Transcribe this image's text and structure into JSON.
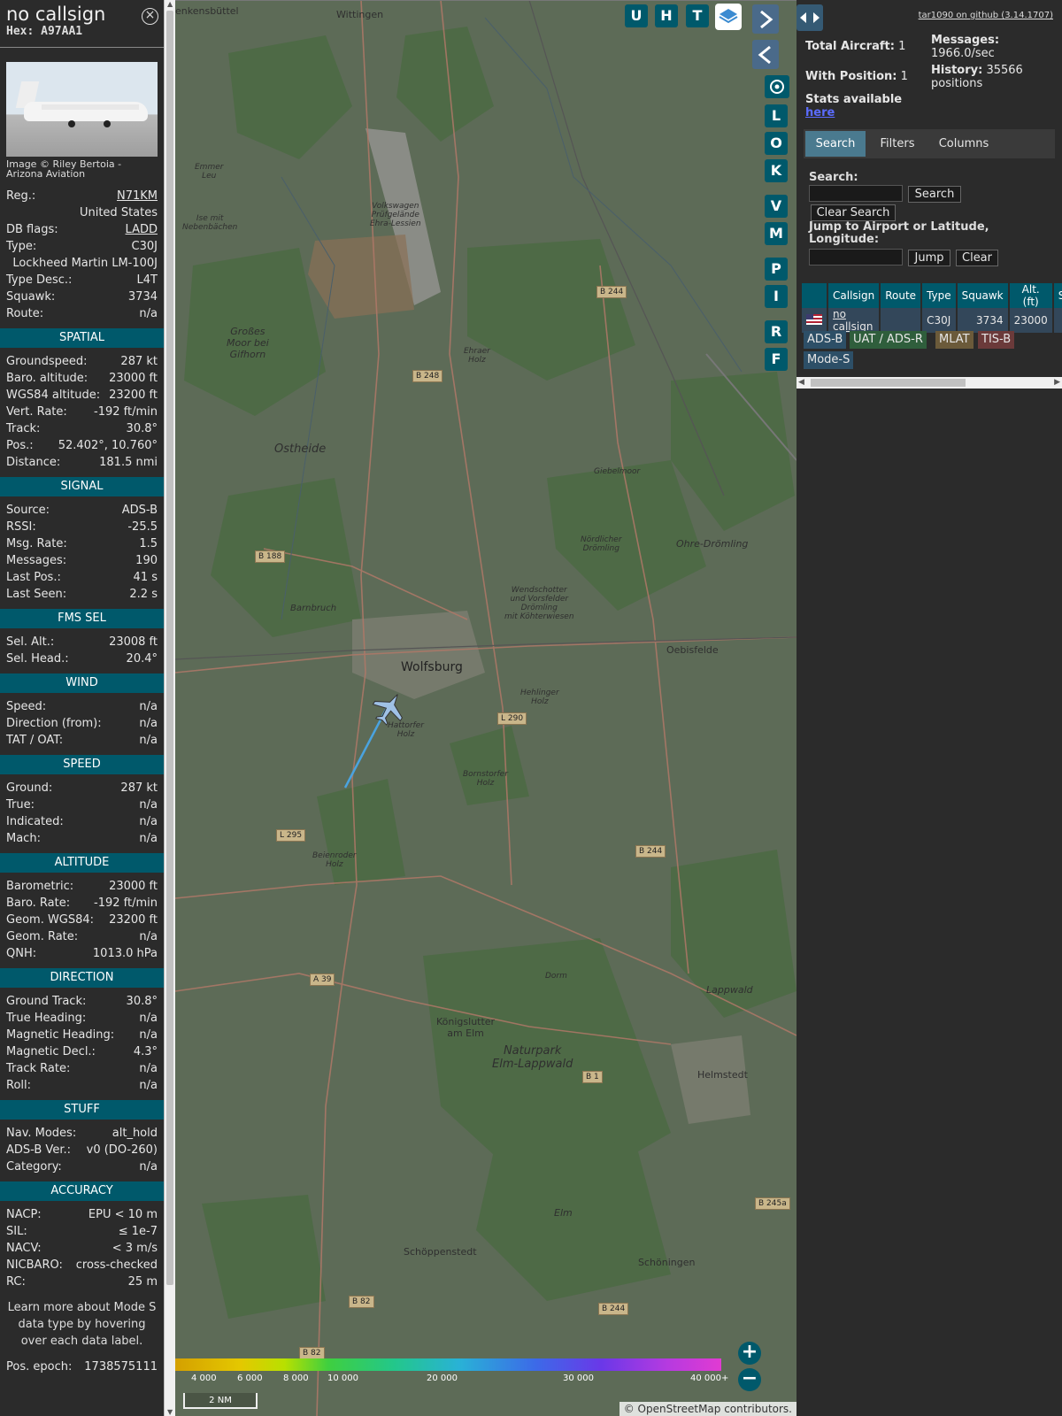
{
  "sidebar": {
    "callsign": "no callsign",
    "hex": "Hex: A97AA1",
    "image_credit": "Image © Riley Bertoia - Arizona Aviation",
    "info": [
      {
        "label": "Reg.:",
        "value": "N71KM",
        "link": true
      },
      {
        "label": "",
        "value": "United States"
      },
      {
        "label": "DB flags:",
        "value": "LADD",
        "link": true
      },
      {
        "label": "Type:",
        "value": "C30J"
      },
      {
        "label": "",
        "value": "Lockheed Martin LM-100J"
      },
      {
        "label": "Type Desc.:",
        "value": "L4T"
      },
      {
        "label": "Squawk:",
        "value": "3734"
      },
      {
        "label": "Route:",
        "value": "n/a"
      }
    ],
    "sections": [
      {
        "title": "SPATIAL",
        "rows": [
          {
            "label": "Groundspeed:",
            "value": "287 kt"
          },
          {
            "label": "Baro. altitude:",
            "value": "23000 ft"
          },
          {
            "label": "WGS84 altitude:",
            "value": "23200 ft"
          },
          {
            "label": "Vert. Rate:",
            "value": "-192 ft/min"
          },
          {
            "label": "Track:",
            "value": "30.8°"
          },
          {
            "label": "Pos.:",
            "value": "52.402°, 10.760°"
          },
          {
            "label": "Distance:",
            "value": "181.5 nmi"
          }
        ]
      },
      {
        "title": "SIGNAL",
        "rows": [
          {
            "label": "Source:",
            "value": "ADS-B"
          },
          {
            "label": "RSSI:",
            "value": "-25.5"
          },
          {
            "label": "Msg. Rate:",
            "value": "1.5"
          },
          {
            "label": "Messages:",
            "value": "190"
          },
          {
            "label": "Last Pos.:",
            "value": "41 s"
          },
          {
            "label": "Last Seen:",
            "value": "2.2 s"
          }
        ]
      },
      {
        "title": "FMS SEL",
        "rows": [
          {
            "label": "Sel. Alt.:",
            "value": "23008 ft"
          },
          {
            "label": "Sel. Head.:",
            "value": "20.4°"
          }
        ]
      },
      {
        "title": "WIND",
        "rows": [
          {
            "label": "Speed:",
            "value": "n/a"
          },
          {
            "label": "Direction (from):",
            "value": "n/a"
          },
          {
            "label": "TAT / OAT:",
            "value": "n/a"
          }
        ]
      },
      {
        "title": "SPEED",
        "rows": [
          {
            "label": "Ground:",
            "value": "287 kt"
          },
          {
            "label": "True:",
            "value": "n/a"
          },
          {
            "label": "Indicated:",
            "value": "n/a"
          },
          {
            "label": "Mach:",
            "value": "n/a"
          }
        ]
      },
      {
        "title": "ALTITUDE",
        "rows": [
          {
            "label": "Barometric:",
            "value": "23000 ft"
          },
          {
            "label": "Baro. Rate:",
            "value": "-192 ft/min"
          },
          {
            "label": "Geom. WGS84:",
            "value": "23200 ft"
          },
          {
            "label": "Geom. Rate:",
            "value": "n/a"
          },
          {
            "label": "QNH:",
            "value": "1013.0 hPa"
          }
        ]
      },
      {
        "title": "DIRECTION",
        "rows": [
          {
            "label": "Ground Track:",
            "value": "30.8°"
          },
          {
            "label": "True Heading:",
            "value": "n/a"
          },
          {
            "label": "Magnetic Heading:",
            "value": "n/a"
          },
          {
            "label": "Magnetic Decl.:",
            "value": "4.3°"
          },
          {
            "label": "Track Rate:",
            "value": "n/a"
          },
          {
            "label": "Roll:",
            "value": "n/a"
          }
        ]
      },
      {
        "title": "STUFF",
        "rows": [
          {
            "label": "Nav. Modes:",
            "value": "alt_hold"
          },
          {
            "label": "ADS-B Ver.:",
            "value": "v0 (DO-260)"
          },
          {
            "label": "Category:",
            "value": "n/a"
          }
        ]
      },
      {
        "title": "ACCURACY",
        "rows": [
          {
            "label": "NACP:",
            "value": "EPU < 10 m"
          },
          {
            "label": "SIL:",
            "value": "≤ 1e-7"
          },
          {
            "label": "NACV:",
            "value": "< 3 m/s"
          },
          {
            "label": "NICBARO:",
            "value": "cross-checked"
          },
          {
            "label": "RC:",
            "value": "25 m"
          }
        ]
      }
    ],
    "learn_more": "Learn more about Mode S data type by hovering over each data label.",
    "pos_epoch_label": "Pos. epoch:",
    "pos_epoch": "1738575111"
  },
  "map": {
    "top_buttons": [
      "U",
      "H",
      "T"
    ],
    "side_buttons": [
      "L",
      "O",
      "K",
      "V",
      "M",
      "P",
      "I",
      "R",
      "F"
    ],
    "places": [
      {
        "name": "Wolfsburg",
        "kind": "city"
      },
      {
        "name": "Oebisfelde",
        "kind": "town"
      },
      {
        "name": "Helmstedt",
        "kind": "town"
      },
      {
        "name": "Königslutter am Elm",
        "kind": "town"
      },
      {
        "name": "Schöppenstedt",
        "kind": "town"
      },
      {
        "name": "Schöningen",
        "kind": "town"
      },
      {
        "name": "Wittingen",
        "kind": "town"
      },
      {
        "name": "Ostheide",
        "kind": "area"
      },
      {
        "name": "Naturpark Elm-Lappwald",
        "kind": "park"
      },
      {
        "name": "Ohre-Drömling",
        "kind": "area"
      },
      {
        "name": "Lappwald",
        "kind": "area"
      },
      {
        "name": "Elm",
        "kind": "area"
      },
      {
        "name": "Barnbruch",
        "kind": "area"
      },
      {
        "name": "Hehlinger Holz",
        "kind": "area"
      },
      {
        "name": "Hattorfer Holz",
        "kind": "area"
      },
      {
        "name": "Bornstorfer Holz",
        "kind": "area"
      },
      {
        "name": "Beienroder Holz",
        "kind": "area"
      },
      {
        "name": "Großes Moor bei Gifhorn",
        "kind": "area"
      },
      {
        "name": "Volkswagen Prüfgelände Ehra-Lessien",
        "kind": "area"
      },
      {
        "name": "Giebelmoor",
        "kind": "area"
      },
      {
        "name": "Nördlicher Drömling",
        "kind": "area"
      },
      {
        "name": "Wendschotter und Vorsfelder Drömling mit Köhterwiesen",
        "kind": "area"
      },
      {
        "name": "Dorm",
        "kind": "area"
      },
      {
        "name": "Ehraer Holz",
        "kind": "area"
      },
      {
        "name": "Emmer Leu",
        "kind": "area"
      },
      {
        "name": "Ise mit Nebenbächen",
        "kind": "area"
      },
      {
        "name": "enkensbüttel",
        "kind": "town"
      }
    ],
    "road_labels": [
      "B 244",
      "B 248",
      "B 188",
      "L 290",
      "L 295",
      "B 244",
      "A 39",
      "B 1",
      "B 245a",
      "B 82",
      "B 244",
      "B 82"
    ],
    "altitude_legend": [
      "4 000",
      "6 000",
      "8 000",
      "10 000",
      "20 000",
      "30 000",
      "40 000+"
    ],
    "scale": "2 NM",
    "attribution": "© OpenStreetMap contributors."
  },
  "right": {
    "github": "tar1090 on github (3.14.1707)",
    "total_label": "Total Aircraft:",
    "total": "1",
    "with_pos_label": "With Position:",
    "with_pos": "1",
    "stats_label": "Stats available",
    "stats_link": "here",
    "messages_label": "Messages:",
    "messages": "1966.0/sec",
    "history_label": "History:",
    "history": "35566 positions",
    "tabs": [
      "Search",
      "Filters",
      "Columns"
    ],
    "search_label": "Search:",
    "search_btn": "Search",
    "clear_search_btn": "Clear Search",
    "jump_label": "Jump to Airport or Latitude, Longitude:",
    "jump_btn": "Jump",
    "clear_btn": "Clear",
    "table": {
      "headers": [
        "",
        "Callsign",
        "Route",
        "Type",
        "Squawk",
        "Alt. (ft)",
        "S"
      ],
      "rows": [
        [
          "",
          "no callsign",
          "",
          "C30J",
          "3734",
          "23000",
          ""
        ]
      ]
    },
    "badges": [
      {
        "label": "ADS-B",
        "color": "#2d4f67"
      },
      {
        "label": "UAT / ADS-R",
        "color": "#2f5e3c"
      },
      {
        "label": "MLAT",
        "color": "#6b5a3a"
      },
      {
        "label": "TIS-B",
        "color": "#6b3a3a"
      },
      {
        "label": "Mode-S",
        "color": "#2d4f67"
      }
    ]
  },
  "colors": {
    "accent": "#00596b",
    "panel": "#2b2b2b",
    "track": "#4aa3df"
  }
}
